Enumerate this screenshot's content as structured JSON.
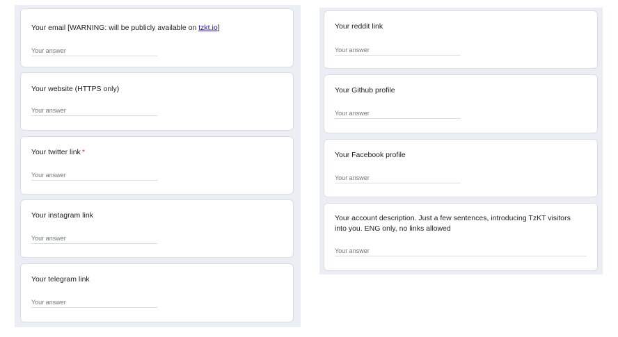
{
  "left_column": {
    "questions": [
      {
        "title_prefix": "Your email [WARNING: will be publicly available on ",
        "link_text": "tzkt.io",
        "title_suffix": "]",
        "placeholder": "Your answer",
        "value": ""
      },
      {
        "title": "Your website (HTTPS only)",
        "placeholder": "Your answer",
        "value": ""
      },
      {
        "title": "Your twitter link",
        "required_mark": "*",
        "placeholder": "Your answer",
        "value": ""
      },
      {
        "title": "Your instagram link",
        "placeholder": "Your answer",
        "value": ""
      },
      {
        "title": "Your telegram link",
        "placeholder": "Your answer",
        "value": ""
      }
    ]
  },
  "right_column": {
    "questions": [
      {
        "title": "Your reddit link",
        "placeholder": "Your answer",
        "value": ""
      },
      {
        "title": "Your Github profile",
        "placeholder": "Your answer",
        "value": ""
      },
      {
        "title": "Your Facebook profile",
        "placeholder": "Your answer",
        "value": ""
      },
      {
        "title": "Your account description. Just a few sentences, introducing TzKT visitors into you. ENG only, no links allowed",
        "placeholder": "Your answer",
        "value": ""
      }
    ]
  },
  "colors": {
    "panel_background": "#eceef6",
    "card_background": "#ffffff",
    "required": "#d93025",
    "link": "#1a0dab"
  }
}
